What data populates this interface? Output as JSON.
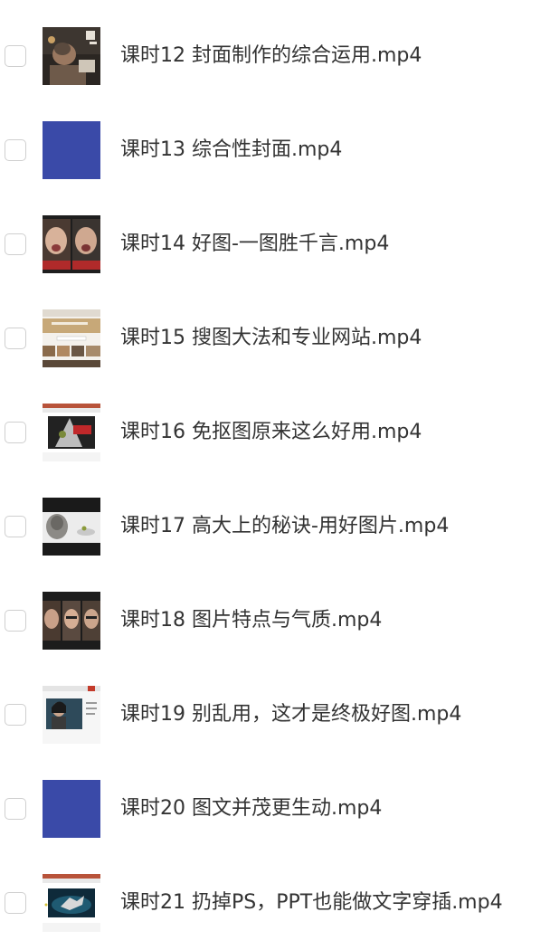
{
  "files": [
    {
      "name": "课时12 封面制作的综合运用.mp4",
      "thumb": "photo-man-reading-thumbnail"
    },
    {
      "name": "课时13 综合性封面.mp4",
      "thumb": "blue-placeholder-thumbnail"
    },
    {
      "name": "课时14 好图-一图胜千言.mp4",
      "thumb": "crying-children-thumbnail"
    },
    {
      "name": "课时15 搜图大法和专业网站.mp4",
      "thumb": "website-screenshot-thumbnail"
    },
    {
      "name": "课时16 免抠图原来这么好用.mp4",
      "thumb": "slide-cutout-thumbnail"
    },
    {
      "name": "课时17 高大上的秘诀-用好图片.mp4",
      "thumb": "slide-wolf-thumbnail"
    },
    {
      "name": "课时18 图片特点与气质.mp4",
      "thumb": "portrait-faces-thumbnail"
    },
    {
      "name": "课时19 别乱用，这才是终极好图.mp4",
      "thumb": "slide-woman-thumbnail"
    },
    {
      "name": "课时20 图文并茂更生动.mp4",
      "thumb": "blue-placeholder-thumbnail"
    },
    {
      "name": "课时21 扔掉PS，PPT也能做文字穿插.mp4",
      "thumb": "slide-diver-thumbnail"
    }
  ],
  "colors": {
    "text": "#333333",
    "checkbox_border": "#cfcfcf",
    "placeholder_blue": "#3a4aa8"
  }
}
